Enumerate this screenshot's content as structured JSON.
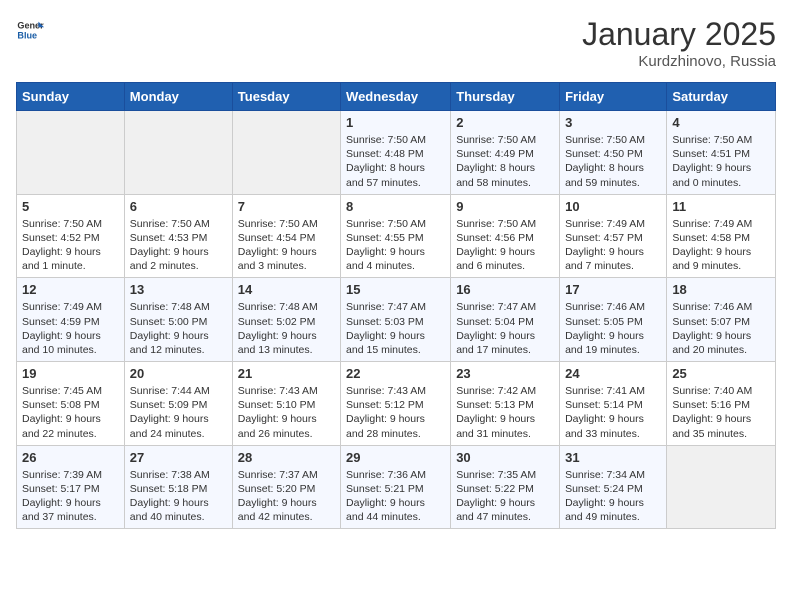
{
  "header": {
    "logo_general": "General",
    "logo_blue": "Blue",
    "title": "January 2025",
    "subtitle": "Kurdzhinovo, Russia"
  },
  "weekdays": [
    "Sunday",
    "Monday",
    "Tuesday",
    "Wednesday",
    "Thursday",
    "Friday",
    "Saturday"
  ],
  "weeks": [
    [
      {
        "day": "",
        "info": ""
      },
      {
        "day": "",
        "info": ""
      },
      {
        "day": "",
        "info": ""
      },
      {
        "day": "1",
        "info": "Sunrise: 7:50 AM\nSunset: 4:48 PM\nDaylight: 8 hours and 57 minutes."
      },
      {
        "day": "2",
        "info": "Sunrise: 7:50 AM\nSunset: 4:49 PM\nDaylight: 8 hours and 58 minutes."
      },
      {
        "day": "3",
        "info": "Sunrise: 7:50 AM\nSunset: 4:50 PM\nDaylight: 8 hours and 59 minutes."
      },
      {
        "day": "4",
        "info": "Sunrise: 7:50 AM\nSunset: 4:51 PM\nDaylight: 9 hours and 0 minutes."
      }
    ],
    [
      {
        "day": "5",
        "info": "Sunrise: 7:50 AM\nSunset: 4:52 PM\nDaylight: 9 hours and 1 minute."
      },
      {
        "day": "6",
        "info": "Sunrise: 7:50 AM\nSunset: 4:53 PM\nDaylight: 9 hours and 2 minutes."
      },
      {
        "day": "7",
        "info": "Sunrise: 7:50 AM\nSunset: 4:54 PM\nDaylight: 9 hours and 3 minutes."
      },
      {
        "day": "8",
        "info": "Sunrise: 7:50 AM\nSunset: 4:55 PM\nDaylight: 9 hours and 4 minutes."
      },
      {
        "day": "9",
        "info": "Sunrise: 7:50 AM\nSunset: 4:56 PM\nDaylight: 9 hours and 6 minutes."
      },
      {
        "day": "10",
        "info": "Sunrise: 7:49 AM\nSunset: 4:57 PM\nDaylight: 9 hours and 7 minutes."
      },
      {
        "day": "11",
        "info": "Sunrise: 7:49 AM\nSunset: 4:58 PM\nDaylight: 9 hours and 9 minutes."
      }
    ],
    [
      {
        "day": "12",
        "info": "Sunrise: 7:49 AM\nSunset: 4:59 PM\nDaylight: 9 hours and 10 minutes."
      },
      {
        "day": "13",
        "info": "Sunrise: 7:48 AM\nSunset: 5:00 PM\nDaylight: 9 hours and 12 minutes."
      },
      {
        "day": "14",
        "info": "Sunrise: 7:48 AM\nSunset: 5:02 PM\nDaylight: 9 hours and 13 minutes."
      },
      {
        "day": "15",
        "info": "Sunrise: 7:47 AM\nSunset: 5:03 PM\nDaylight: 9 hours and 15 minutes."
      },
      {
        "day": "16",
        "info": "Sunrise: 7:47 AM\nSunset: 5:04 PM\nDaylight: 9 hours and 17 minutes."
      },
      {
        "day": "17",
        "info": "Sunrise: 7:46 AM\nSunset: 5:05 PM\nDaylight: 9 hours and 19 minutes."
      },
      {
        "day": "18",
        "info": "Sunrise: 7:46 AM\nSunset: 5:07 PM\nDaylight: 9 hours and 20 minutes."
      }
    ],
    [
      {
        "day": "19",
        "info": "Sunrise: 7:45 AM\nSunset: 5:08 PM\nDaylight: 9 hours and 22 minutes."
      },
      {
        "day": "20",
        "info": "Sunrise: 7:44 AM\nSunset: 5:09 PM\nDaylight: 9 hours and 24 minutes."
      },
      {
        "day": "21",
        "info": "Sunrise: 7:43 AM\nSunset: 5:10 PM\nDaylight: 9 hours and 26 minutes."
      },
      {
        "day": "22",
        "info": "Sunrise: 7:43 AM\nSunset: 5:12 PM\nDaylight: 9 hours and 28 minutes."
      },
      {
        "day": "23",
        "info": "Sunrise: 7:42 AM\nSunset: 5:13 PM\nDaylight: 9 hours and 31 minutes."
      },
      {
        "day": "24",
        "info": "Sunrise: 7:41 AM\nSunset: 5:14 PM\nDaylight: 9 hours and 33 minutes."
      },
      {
        "day": "25",
        "info": "Sunrise: 7:40 AM\nSunset: 5:16 PM\nDaylight: 9 hours and 35 minutes."
      }
    ],
    [
      {
        "day": "26",
        "info": "Sunrise: 7:39 AM\nSunset: 5:17 PM\nDaylight: 9 hours and 37 minutes."
      },
      {
        "day": "27",
        "info": "Sunrise: 7:38 AM\nSunset: 5:18 PM\nDaylight: 9 hours and 40 minutes."
      },
      {
        "day": "28",
        "info": "Sunrise: 7:37 AM\nSunset: 5:20 PM\nDaylight: 9 hours and 42 minutes."
      },
      {
        "day": "29",
        "info": "Sunrise: 7:36 AM\nSunset: 5:21 PM\nDaylight: 9 hours and 44 minutes."
      },
      {
        "day": "30",
        "info": "Sunrise: 7:35 AM\nSunset: 5:22 PM\nDaylight: 9 hours and 47 minutes."
      },
      {
        "day": "31",
        "info": "Sunrise: 7:34 AM\nSunset: 5:24 PM\nDaylight: 9 hours and 49 minutes."
      },
      {
        "day": "",
        "info": ""
      }
    ]
  ]
}
